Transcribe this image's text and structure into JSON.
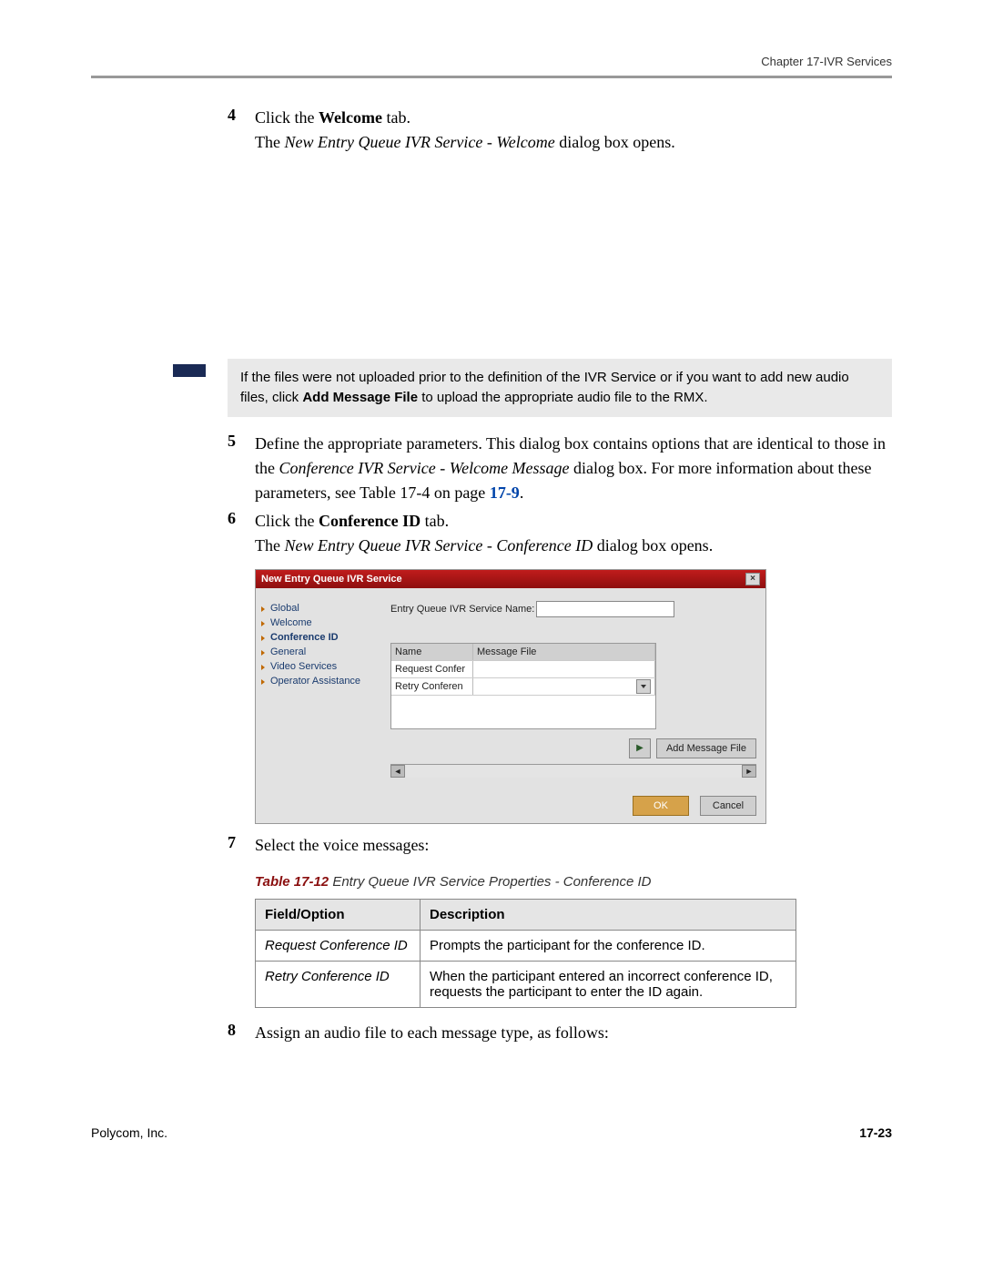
{
  "header": {
    "chapter": "Chapter 17-IVR Services"
  },
  "steps": {
    "s4": {
      "num": "4",
      "line1_pre": "Click the ",
      "line1_bold": "Welcome",
      "line1_post": " tab.",
      "line2_pre": "The ",
      "line2_italic": "New Entry Queue IVR Service - Welcome",
      "line2_post": " dialog box opens."
    },
    "note": {
      "text_pre": "If the files were not uploaded prior to the definition of the IVR Service or if you want to add new audio files, click ",
      "text_bold": "Add Message File",
      "text_post": " to upload the appropriate audio file to the RMX."
    },
    "s5": {
      "num": "5",
      "line1": "Define the appropriate parameters. This dialog box contains options that are identical to those in the ",
      "line1_italic": "Conference IVR Service - Welcome Message",
      "line1_post": " dialog box. For more information about these parameters, see Table 17-4 on page ",
      "page_ref": "17-9",
      "line1_end": "."
    },
    "s6": {
      "num": "6",
      "line1_pre": "Click the ",
      "line1_bold": "Conference ID",
      "line1_post": " tab.",
      "line2_pre": "The ",
      "line2_italic": "New Entry Queue IVR Service - Conference ID",
      "line2_post": " dialog box opens."
    },
    "s7": {
      "num": "7",
      "text": "Select the voice messages:"
    },
    "s8": {
      "num": "8",
      "text": "Assign an audio file to each message type, as follows:"
    }
  },
  "dialog": {
    "title": "New Entry Queue IVR Service",
    "sidebar": [
      "Global",
      "Welcome",
      "Conference ID",
      "General",
      "Video Services",
      "Operator Assistance"
    ],
    "active_index": 2,
    "field_label": "Entry Queue IVR Service Name:",
    "field_value": "",
    "table_headers": {
      "name": "Name",
      "msgfile": "Message File"
    },
    "rows": [
      {
        "name": "Request Confer",
        "msgfile": ""
      },
      {
        "name": "Retry Conferen",
        "msgfile": ""
      }
    ],
    "add_btn": "Add Message File",
    "ok": "OK",
    "cancel": "Cancel"
  },
  "table_caption": {
    "num": "Table 17-12",
    "title": " Entry Queue IVR Service Properties - Conference ID"
  },
  "props_table": {
    "headers": {
      "field": "Field/Option",
      "desc": "Description"
    },
    "rows": [
      {
        "field": "Request Conference ID",
        "desc": "Prompts the participant for the conference ID."
      },
      {
        "field": "Retry Conference ID",
        "desc": "When the participant entered an incorrect conference ID, requests the participant to enter the ID again."
      }
    ]
  },
  "footer": {
    "company": "Polycom, Inc.",
    "page": "17-23"
  }
}
